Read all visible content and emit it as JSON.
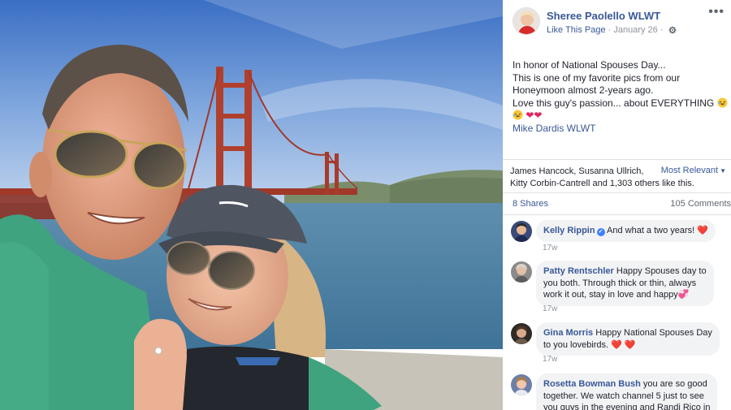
{
  "post": {
    "page_name": "Sheree Paolello WLWT",
    "like_page": "Like This Page",
    "separator": " · ",
    "date": "January 26",
    "dot": " · ",
    "more": "•••",
    "text_lines": [
      "In honor of National Spouses Day...",
      "This is one of my favorite pics from our",
      "Honeymoon almost 2-years ago.",
      "Love this guy's passion... about EVERYTHING"
    ],
    "tagged": "Mike Dardis WLWT"
  },
  "reactions": {
    "likes_line1": "James Hancock, Susanna Ullrich,",
    "likes_line2": "Kitty Corbin-Cantrell and 1,303 others like this.",
    "sort_label": "Most Relevant",
    "shares": "8 Shares",
    "comments": "105 Comments"
  },
  "comments": [
    {
      "author": "Kelly Rippin",
      "verified": "✓",
      "lines": [
        "And what a two years! ❤️"
      ],
      "time": "17w"
    },
    {
      "author": "Patty Rentschler",
      "lines": [
        "Happy Spouses day to",
        "you both. Through thick or thin, always",
        "work it out, stay in love and happy💞"
      ],
      "time": "17w"
    },
    {
      "author": "Gina Morris",
      "lines": [
        "Happy National Spouses Day",
        "to you lovebirds. ❤️ ❤️"
      ],
      "time": "17w"
    },
    {
      "author": "Rosetta Bowman Bush",
      "lines": [
        "you are so good",
        "together. We watch channel 5 just to see",
        "you guys in the evening and Randi Rico in"
      ],
      "time": ""
    }
  ],
  "colors": {
    "link_blue": "#385898",
    "bubble_bg": "#f2f3f5",
    "divider": "#dddfe2"
  }
}
